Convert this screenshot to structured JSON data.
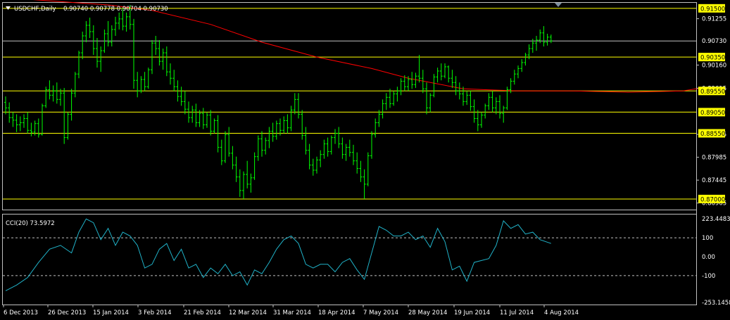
{
  "window": {
    "symbol": "USDCHF,Daily",
    "ohlc": "0.90740 0.90778 0.90704 0.90730"
  },
  "colors": {
    "background": "#000000",
    "bull": "#00ff00",
    "ma": "#ff0000",
    "cci": "#20b2c8",
    "hline": "#ffff00",
    "frame": "#c0c0c0",
    "text": "#ffffff",
    "badge": "#ffff00"
  },
  "icons": {
    "menu": "triangle-down-icon",
    "shift_marker": "triangle-down-marker-icon"
  },
  "main_axis": {
    "ymin": 0.8675,
    "ymax": 0.9163,
    "price_ticks": [
      "0.91255",
      "0.90160",
      "0.89615",
      "0.88525",
      "0.87985",
      "0.87445",
      "0.86905"
    ],
    "current_price": "0.90730",
    "level_badges": [
      "0.91500",
      "0.90350",
      "0.89550",
      "0.89050",
      "0.88550",
      "0.87000"
    ]
  },
  "cci_axis": {
    "title": "CCI(20) 73.5972",
    "ymin": -253.1458,
    "ymax": 223.4483,
    "ticks": [
      "223.4483",
      "100",
      "0.00",
      "-100",
      "-253.1458"
    ]
  },
  "x_labels": [
    "6 Dec 2013",
    "26 Dec 2013",
    "15 Jan 2014",
    "3 Feb 2014",
    "21 Feb 2014",
    "12 Mar 2014",
    "31 Mar 2014",
    "18 Apr 2014",
    "7 May 2014",
    "28 May 2014",
    "19 Jun 2014",
    "11 Jul 2014",
    "4 Aug 2014"
  ],
  "chart_data": [
    {
      "type": "candlestick",
      "title": "USDCHF,Daily",
      "ylim": [
        0.8675,
        0.9163
      ],
      "horizontal_levels": [
        0.915,
        0.9035,
        0.8955,
        0.8905,
        0.8855,
        0.87
      ],
      "moving_average": [
        [
          0,
          0.9175
        ],
        [
          28,
          0.9158
        ],
        [
          40,
          0.9145
        ],
        [
          56,
          0.9112
        ],
        [
          70,
          0.907
        ],
        [
          85,
          0.9035
        ],
        [
          100,
          0.9008
        ],
        [
          110,
          0.8985
        ],
        [
          125,
          0.896
        ],
        [
          140,
          0.8955
        ],
        [
          155,
          0.8955
        ],
        [
          170,
          0.8952
        ],
        [
          185,
          0.8955
        ],
        [
          190,
          0.8962
        ]
      ],
      "candles": [
        [
          0,
          0.8928,
          0.8942,
          0.89,
          0.8915
        ],
        [
          1,
          0.8915,
          0.8928,
          0.888,
          0.8892
        ],
        [
          2,
          0.8892,
          0.8905,
          0.887,
          0.8886
        ],
        [
          3,
          0.8886,
          0.89,
          0.8858,
          0.8875
        ],
        [
          4,
          0.8875,
          0.8895,
          0.886,
          0.888
        ],
        [
          5,
          0.888,
          0.89,
          0.8868,
          0.889
        ],
        [
          6,
          0.889,
          0.8905,
          0.8855,
          0.8862
        ],
        [
          7,
          0.8862,
          0.888,
          0.8848,
          0.8858
        ],
        [
          8,
          0.8858,
          0.8885,
          0.885,
          0.8878
        ],
        [
          9,
          0.8878,
          0.889,
          0.8845,
          0.8852
        ],
        [
          10,
          0.8852,
          0.8925,
          0.885,
          0.892
        ],
        [
          11,
          0.892,
          0.8965,
          0.8915,
          0.8958
        ],
        [
          12,
          0.8958,
          0.898,
          0.8935,
          0.8945
        ],
        [
          13,
          0.8945,
          0.8968,
          0.893,
          0.8955
        ],
        [
          14,
          0.8955,
          0.8975,
          0.8925,
          0.8935
        ],
        [
          15,
          0.8935,
          0.896,
          0.892,
          0.895
        ],
        [
          16,
          0.895,
          0.8962,
          0.883,
          0.8845
        ],
        [
          17,
          0.8845,
          0.8905,
          0.884,
          0.89
        ],
        [
          18,
          0.89,
          0.896,
          0.8885,
          0.895
        ],
        [
          19,
          0.895,
          0.9,
          0.894,
          0.8995
        ],
        [
          20,
          0.8995,
          0.905,
          0.8985,
          0.9045
        ],
        [
          21,
          0.9045,
          0.9095,
          0.903,
          0.9085
        ],
        [
          22,
          0.9085,
          0.912,
          0.907,
          0.911
        ],
        [
          23,
          0.911,
          0.9128,
          0.908,
          0.9095
        ],
        [
          24,
          0.9095,
          0.911,
          0.904,
          0.9055
        ],
        [
          25,
          0.9055,
          0.908,
          0.901,
          0.9025
        ],
        [
          26,
          0.9025,
          0.906,
          0.9,
          0.905
        ],
        [
          27,
          0.905,
          0.91,
          0.9045,
          0.909
        ],
        [
          28,
          0.909,
          0.912,
          0.906,
          0.907
        ],
        [
          29,
          0.907,
          0.911,
          0.906,
          0.91
        ],
        [
          30,
          0.91,
          0.913,
          0.9085,
          0.9115
        ],
        [
          31,
          0.9115,
          0.914,
          0.91,
          0.9125
        ],
        [
          32,
          0.9125,
          0.915,
          0.9098,
          0.9108
        ],
        [
          33,
          0.9108,
          0.914,
          0.9095,
          0.913
        ],
        [
          34,
          0.913,
          0.9158,
          0.91,
          0.9112
        ],
        [
          35,
          0.9112,
          0.9125,
          0.896,
          0.898
        ],
        [
          36,
          0.898,
          0.9,
          0.894,
          0.8955
        ],
        [
          37,
          0.8955,
          0.899,
          0.895,
          0.8982
        ],
        [
          38,
          0.8982,
          0.9,
          0.8955,
          0.8965
        ],
        [
          39,
          0.8965,
          0.901,
          0.896,
          0.9005
        ],
        [
          40,
          0.9005,
          0.9075,
          0.8995,
          0.9068
        ],
        [
          41,
          0.9068,
          0.9085,
          0.904,
          0.9055
        ],
        [
          42,
          0.9055,
          0.9075,
          0.9015,
          0.9025
        ],
        [
          43,
          0.9025,
          0.9055,
          0.9005,
          0.9045
        ],
        [
          44,
          0.9045,
          0.906,
          0.899,
          0.9
        ],
        [
          45,
          0.9,
          0.902,
          0.897,
          0.8985
        ],
        [
          46,
          0.8985,
          0.9005,
          0.8955,
          0.8965
        ],
        [
          47,
          0.8965,
          0.898,
          0.893,
          0.8942
        ],
        [
          48,
          0.8942,
          0.8965,
          0.892,
          0.893
        ],
        [
          49,
          0.893,
          0.8955,
          0.89,
          0.8912
        ],
        [
          50,
          0.8912,
          0.893,
          0.888,
          0.8892
        ],
        [
          51,
          0.8892,
          0.892,
          0.888,
          0.891
        ],
        [
          52,
          0.891,
          0.8925,
          0.887,
          0.888
        ],
        [
          53,
          0.888,
          0.891,
          0.887,
          0.8902
        ],
        [
          54,
          0.8902,
          0.8915,
          0.8865,
          0.8875
        ],
        [
          55,
          0.8875,
          0.8905,
          0.8868,
          0.8898
        ],
        [
          56,
          0.8898,
          0.891,
          0.885,
          0.886
        ],
        [
          57,
          0.886,
          0.889,
          0.8855,
          0.8885
        ],
        [
          58,
          0.8885,
          0.8898,
          0.881,
          0.8822
        ],
        [
          59,
          0.8822,
          0.884,
          0.878,
          0.879
        ],
        [
          60,
          0.879,
          0.886,
          0.8785,
          0.8852
        ],
        [
          61,
          0.8852,
          0.887,
          0.88,
          0.8808
        ],
        [
          62,
          0.8808,
          0.8825,
          0.877,
          0.878
        ],
        [
          63,
          0.878,
          0.88,
          0.874,
          0.8752
        ],
        [
          64,
          0.8752,
          0.877,
          0.8705,
          0.872
        ],
        [
          65,
          0.872,
          0.8765,
          0.87,
          0.8758
        ],
        [
          66,
          0.8758,
          0.879,
          0.8725,
          0.8735
        ],
        [
          67,
          0.8735,
          0.876,
          0.8715,
          0.875
        ],
        [
          68,
          0.875,
          0.881,
          0.8745,
          0.88
        ],
        [
          69,
          0.88,
          0.885,
          0.879,
          0.8842
        ],
        [
          70,
          0.8842,
          0.886,
          0.88,
          0.8815
        ],
        [
          71,
          0.8815,
          0.8845,
          0.8805,
          0.8838
        ],
        [
          72,
          0.8838,
          0.887,
          0.882,
          0.886
        ],
        [
          73,
          0.886,
          0.888,
          0.8835,
          0.8848
        ],
        [
          74,
          0.8848,
          0.8885,
          0.884,
          0.8878
        ],
        [
          75,
          0.8878,
          0.889,
          0.885,
          0.8862
        ],
        [
          76,
          0.8862,
          0.8895,
          0.8855,
          0.8885
        ],
        [
          77,
          0.8885,
          0.89,
          0.8855,
          0.8868
        ],
        [
          78,
          0.8868,
          0.892,
          0.886,
          0.891
        ],
        [
          79,
          0.891,
          0.895,
          0.89,
          0.8935
        ],
        [
          80,
          0.8935,
          0.895,
          0.889,
          0.89
        ],
        [
          81,
          0.89,
          0.891,
          0.884,
          0.885
        ],
        [
          82,
          0.885,
          0.887,
          0.8805,
          0.8815
        ],
        [
          83,
          0.8815,
          0.883,
          0.877,
          0.878
        ],
        [
          84,
          0.878,
          0.8795,
          0.8755,
          0.8768
        ],
        [
          85,
          0.8768,
          0.88,
          0.876,
          0.8792
        ],
        [
          86,
          0.8792,
          0.8815,
          0.8775,
          0.8805
        ],
        [
          87,
          0.8805,
          0.884,
          0.8795,
          0.883
        ],
        [
          88,
          0.883,
          0.8845,
          0.88,
          0.8812
        ],
        [
          89,
          0.8812,
          0.885,
          0.8805,
          0.8845
        ],
        [
          90,
          0.8845,
          0.8865,
          0.883,
          0.8855
        ],
        [
          91,
          0.8855,
          0.887,
          0.882,
          0.883
        ],
        [
          92,
          0.883,
          0.8845,
          0.8795,
          0.8805
        ],
        [
          93,
          0.8805,
          0.883,
          0.879,
          0.8822
        ],
        [
          94,
          0.8822,
          0.884,
          0.88,
          0.881
        ],
        [
          95,
          0.881,
          0.8828,
          0.878,
          0.879
        ],
        [
          96,
          0.879,
          0.881,
          0.876,
          0.8772
        ],
        [
          97,
          0.8772,
          0.879,
          0.874,
          0.8752
        ],
        [
          98,
          0.8752,
          0.877,
          0.87,
          0.8735
        ],
        [
          99,
          0.8735,
          0.881,
          0.873,
          0.8802
        ],
        [
          100,
          0.8802,
          0.886,
          0.8795,
          0.8852
        ],
        [
          101,
          0.8852,
          0.889,
          0.8845,
          0.888
        ],
        [
          102,
          0.888,
          0.891,
          0.887,
          0.89
        ],
        [
          103,
          0.89,
          0.8935,
          0.889,
          0.8925
        ],
        [
          104,
          0.8925,
          0.895,
          0.891,
          0.894
        ],
        [
          105,
          0.894,
          0.896,
          0.8915,
          0.8925
        ],
        [
          106,
          0.8925,
          0.8955,
          0.892,
          0.8948
        ],
        [
          107,
          0.8948,
          0.8965,
          0.893,
          0.8955
        ],
        [
          108,
          0.8955,
          0.8985,
          0.8945,
          0.8978
        ],
        [
          109,
          0.8978,
          0.8992,
          0.8955,
          0.8965
        ],
        [
          110,
          0.8965,
          0.899,
          0.8955,
          0.8982
        ],
        [
          111,
          0.8982,
          0.9,
          0.896,
          0.897
        ],
        [
          112,
          0.897,
          0.8998,
          0.8962,
          0.899
        ],
        [
          113,
          0.899,
          0.904,
          0.8975,
          0.8985
        ],
        [
          114,
          0.8985,
          0.9005,
          0.895,
          0.896
        ],
        [
          115,
          0.896,
          0.8975,
          0.89,
          0.8915
        ],
        [
          116,
          0.8915,
          0.895,
          0.8905,
          0.8945
        ],
        [
          117,
          0.8945,
          0.8995,
          0.894,
          0.8988
        ],
        [
          118,
          0.8988,
          0.901,
          0.8975,
          0.9002
        ],
        [
          119,
          0.9002,
          0.902,
          0.898,
          0.899
        ],
        [
          120,
          0.899,
          0.902,
          0.8985,
          0.9012
        ],
        [
          121,
          0.9012,
          0.9015,
          0.8975,
          0.8985
        ],
        [
          122,
          0.8985,
          0.9005,
          0.8962,
          0.8975
        ],
        [
          123,
          0.8975,
          0.899,
          0.8945,
          0.8955
        ],
        [
          124,
          0.8955,
          0.8975,
          0.8935,
          0.8948
        ],
        [
          125,
          0.8948,
          0.8965,
          0.892,
          0.893
        ],
        [
          126,
          0.893,
          0.8955,
          0.8922,
          0.8945
        ],
        [
          127,
          0.8945,
          0.8955,
          0.8908,
          0.8918
        ],
        [
          128,
          0.8918,
          0.8935,
          0.888,
          0.889
        ],
        [
          129,
          0.889,
          0.891,
          0.886,
          0.8875
        ],
        [
          130,
          0.8875,
          0.8905,
          0.8868,
          0.8898
        ],
        [
          131,
          0.8898,
          0.8925,
          0.889,
          0.892
        ],
        [
          132,
          0.892,
          0.895,
          0.891,
          0.894
        ],
        [
          133,
          0.894,
          0.8955,
          0.8905,
          0.8915
        ],
        [
          134,
          0.8915,
          0.894,
          0.89,
          0.893
        ],
        [
          135,
          0.893,
          0.8945,
          0.889,
          0.8902
        ],
        [
          136,
          0.8902,
          0.892,
          0.888,
          0.8915
        ],
        [
          137,
          0.8915,
          0.8965,
          0.891,
          0.8958
        ],
        [
          138,
          0.8958,
          0.8985,
          0.895,
          0.8978
        ],
        [
          139,
          0.8978,
          0.9005,
          0.897,
          0.8995
        ],
        [
          140,
          0.8995,
          0.9015,
          0.8985,
          0.9008
        ],
        [
          141,
          0.9008,
          0.903,
          0.9,
          0.9022
        ],
        [
          142,
          0.9022,
          0.9045,
          0.9015,
          0.904
        ],
        [
          143,
          0.904,
          0.9065,
          0.903,
          0.9055
        ],
        [
          144,
          0.9055,
          0.9078,
          0.9045,
          0.9068
        ],
        [
          145,
          0.9068,
          0.9085,
          0.905,
          0.9075
        ],
        [
          146,
          0.9075,
          0.91,
          0.9068,
          0.9092
        ],
        [
          147,
          0.9092,
          0.9108,
          0.906,
          0.907
        ],
        [
          148,
          0.907,
          0.909,
          0.9062,
          0.9082
        ],
        [
          149,
          0.9082,
          0.9088,
          0.9068,
          0.9073
        ]
      ]
    },
    {
      "type": "line",
      "title": "CCI(20) 73.5972",
      "ylim": [
        -253.1458,
        223.4483
      ],
      "levels": [
        100,
        -100
      ],
      "x": [
        0,
        3,
        6,
        9,
        12,
        15,
        18,
        20,
        22,
        24,
        26,
        28,
        30,
        32,
        34,
        36,
        38,
        40,
        42,
        44,
        46,
        48,
        50,
        52,
        54,
        56,
        58,
        60,
        62,
        64,
        66,
        68,
        70,
        72,
        74,
        76,
        78,
        80,
        82,
        84,
        86,
        88,
        90,
        92,
        94,
        96,
        98,
        100,
        102,
        104,
        106,
        108,
        110,
        112,
        114,
        116,
        118,
        120,
        122,
        124,
        126,
        128,
        130,
        132,
        134,
        136,
        138,
        140,
        142,
        144,
        146,
        149
      ],
      "values": [
        -180,
        -150,
        -110,
        -30,
        40,
        60,
        20,
        130,
        200,
        180,
        90,
        150,
        60,
        130,
        110,
        60,
        -60,
        -40,
        40,
        70,
        -20,
        40,
        -60,
        -40,
        -110,
        -60,
        -90,
        -40,
        -100,
        -80,
        -150,
        -70,
        -90,
        -30,
        40,
        90,
        110,
        70,
        -40,
        -60,
        -40,
        -40,
        -80,
        -30,
        -10,
        -70,
        -120,
        20,
        160,
        140,
        110,
        110,
        130,
        90,
        110,
        50,
        150,
        80,
        -70,
        -50,
        -130,
        -30,
        -20,
        -10,
        60,
        190,
        150,
        170,
        120,
        130,
        90,
        70
      ]
    }
  ]
}
